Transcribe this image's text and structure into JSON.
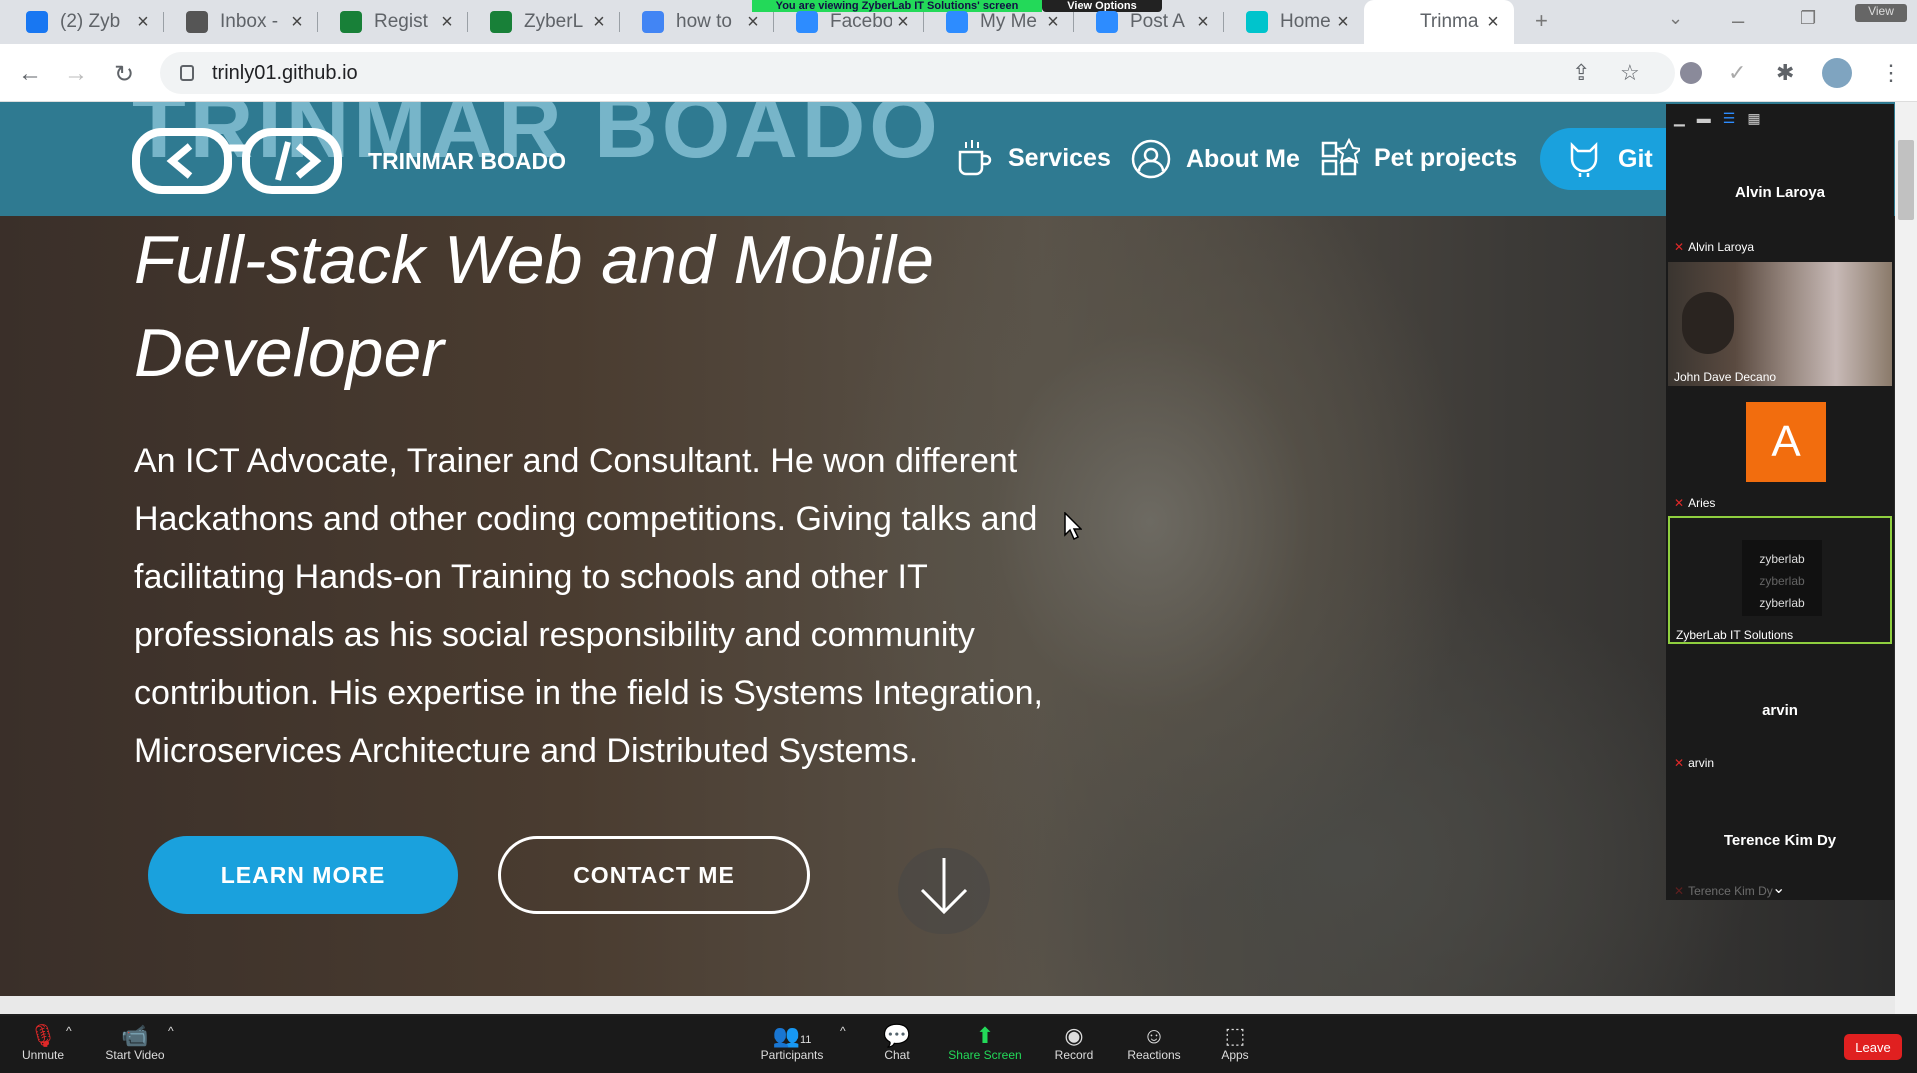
{
  "zoom_share_banner": {
    "text": "You are viewing ZyberLab IT Solutions' screen",
    "view_options": "View Options"
  },
  "tabs": [
    {
      "title": "(2) Zyb",
      "icon": "facebook-icon",
      "color": "#1877f2"
    },
    {
      "title": "Inbox -",
      "icon": "mail-icon",
      "color": "#555555"
    },
    {
      "title": "Regist",
      "icon": "sheets-icon",
      "color": "#188038"
    },
    {
      "title": "ZyberL",
      "icon": "sheets-icon",
      "color": "#188038"
    },
    {
      "title": "how to",
      "icon": "google-icon",
      "color": "#4285f4"
    },
    {
      "title": "Facebo",
      "icon": "zoom-icon",
      "color": "#2d8cff"
    },
    {
      "title": "My Me",
      "icon": "zoom-icon",
      "color": "#2d8cff"
    },
    {
      "title": "Post A",
      "icon": "zoom-icon",
      "color": "#2d8cff"
    },
    {
      "title": "Home",
      "icon": "canva-icon",
      "color": "#00c4cc"
    },
    {
      "title": "Trinma",
      "icon": "none",
      "color": "#ffffff"
    }
  ],
  "address": {
    "url": "trinly01.github.io"
  },
  "site": {
    "big_name": "TRINMAR BOADO",
    "brand": "TRINMAR BOADO",
    "nav": {
      "services": "Services",
      "about": "About Me",
      "projects": "Pet projects",
      "github": "Git"
    },
    "headline": "Full-stack Web and Mobile Developer",
    "paragraph": "An ICT Advocate, Trainer and Consultant. He won different Hackathons and other coding competitions. Giving talks and facilitating Hands-on Training to schools and other IT professionals as his social responsibility and community contribution. His expertise in the field is Systems Integration, Microservices Architecture and Distributed Systems.",
    "learn_more": "LEARN MORE",
    "contact_me": "CONTACT ME"
  },
  "gallery": {
    "header_name": "Alvin Laroya",
    "participants": [
      {
        "name": "Alvin Laroya",
        "muted": true
      },
      {
        "name": "John Dave Decano",
        "muted": false
      },
      {
        "name": "Aries",
        "avatar_letter": "A",
        "muted": true
      },
      {
        "name": "ZyberLab IT Solutions",
        "logo_text": "zyberlab",
        "muted": false
      },
      {
        "name": "arvin",
        "title": "arvin",
        "muted": true
      },
      {
        "name": "Terence Kim Dy",
        "title": "Terence Kim Dy",
        "muted": true
      }
    ],
    "view_label": "View"
  },
  "zoom_toolbar": {
    "unmute": "Unmute",
    "start_video": "Start Video",
    "participants": "Participants",
    "participants_count": "11",
    "chat": "Chat",
    "share_screen": "Share Screen",
    "record": "Record",
    "reactions": "Reactions",
    "apps": "Apps",
    "leave": "Leave"
  },
  "colors": {
    "accent": "#1aa1dd",
    "header": "#2f7a91",
    "leave": "#e02020",
    "share_green": "#23d959"
  }
}
